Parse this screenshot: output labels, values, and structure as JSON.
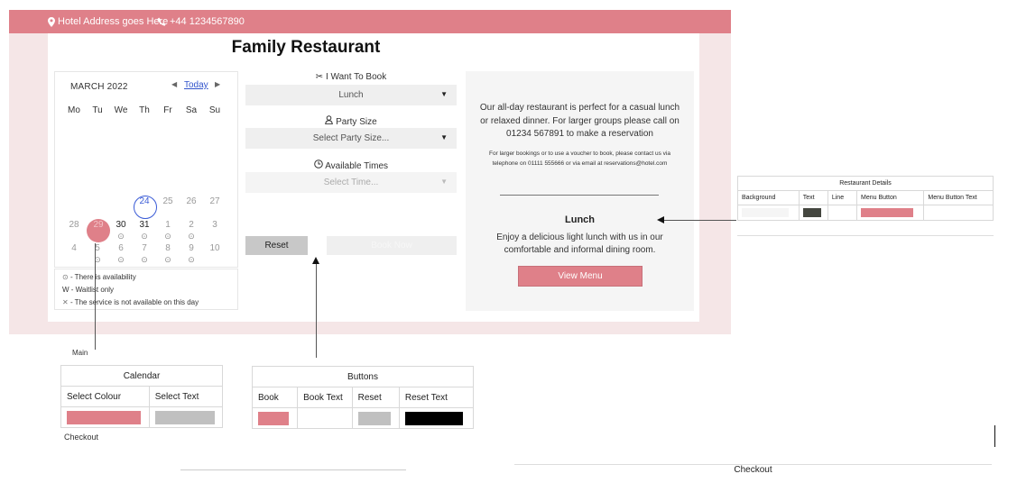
{
  "header": {
    "address": "Hotel Address goes Here",
    "phone": "+44 1234567890",
    "address_icon": "map-pin-icon",
    "phone_icon": "phone-icon",
    "bar_color": "#df8089"
  },
  "page": {
    "title": "Family Restaurant"
  },
  "calendar": {
    "month_label": "MARCH 2022",
    "today_label": "Today",
    "prev_icon": "caret-left-icon",
    "next_icon": "caret-right-icon",
    "weekdays": [
      "Mo",
      "Tu",
      "We",
      "Th",
      "Fr",
      "Sa",
      "Su"
    ],
    "days_row1": [
      "24",
      "25",
      "26",
      "27"
    ],
    "days_row2": [
      "28",
      "29",
      "30",
      "31",
      "1",
      "2",
      "3"
    ],
    "days_row3": [
      "4",
      "5",
      "6",
      "7",
      "8",
      "9",
      "10"
    ],
    "selected_day": "29",
    "select_color": "#df8089"
  },
  "legend": {
    "available": "- There is availability",
    "waitlist": "W - Waitlist only",
    "unavailable": "- The service is not available on this day",
    "available_icon": "check-circle-icon",
    "unavailable_icon": "cross-icon"
  },
  "booking": {
    "book_label": "I Want To Book",
    "book_value": "Lunch",
    "party_label": "Party Size",
    "party_placeholder": "Select Party Size...",
    "times_label": "Available Times",
    "times_placeholder": "Select Time...",
    "reset_label": "Reset",
    "book_now_label": "Book Now",
    "book_icon": "cutlery-icon",
    "party_icon": "person-icon",
    "times_icon": "clock-icon"
  },
  "info": {
    "text": "Our all-day restaurant is perfect for a casual lunch or relaxed dinner. For larger groups please call on 01234 567891 to make a reservation",
    "small_text": "For larger bookings or to use a voucher to book, please contact us via telephone on 01111 555666 or via email at reservations@hotel.com",
    "service_title": "Lunch",
    "service_desc": "Enjoy a delicious light lunch with us in our comfortable and informal dining room.",
    "menu_button": "View Menu"
  },
  "restaurant_details": {
    "title": "Restaurant Details",
    "columns": [
      "Background",
      "Text",
      "Line",
      "Menu Button",
      "Menu Button Text"
    ],
    "colors": {
      "background": "#f5f5f5",
      "text": "#44463f",
      "line": "#ffffff",
      "menu_button": "#df8089",
      "menu_button_text": "#ffffff"
    }
  },
  "calendar_table": {
    "above_label": "Main",
    "title": "Calendar",
    "columns": [
      "Select Colour",
      "Select Text"
    ],
    "colors": {
      "select_colour": "#df8089",
      "select_text": "#c0c0c0"
    },
    "below_label": "Checkout"
  },
  "buttons_table": {
    "title": "Buttons",
    "columns": [
      "Book",
      "Book Text",
      "Reset",
      "Reset Text"
    ],
    "colors": {
      "book": "#df8089",
      "book_text": "#ffffff",
      "reset": "#c0c0c0",
      "reset_text": "#000000"
    }
  },
  "bottom": {
    "checkout_label": "Checkout"
  }
}
